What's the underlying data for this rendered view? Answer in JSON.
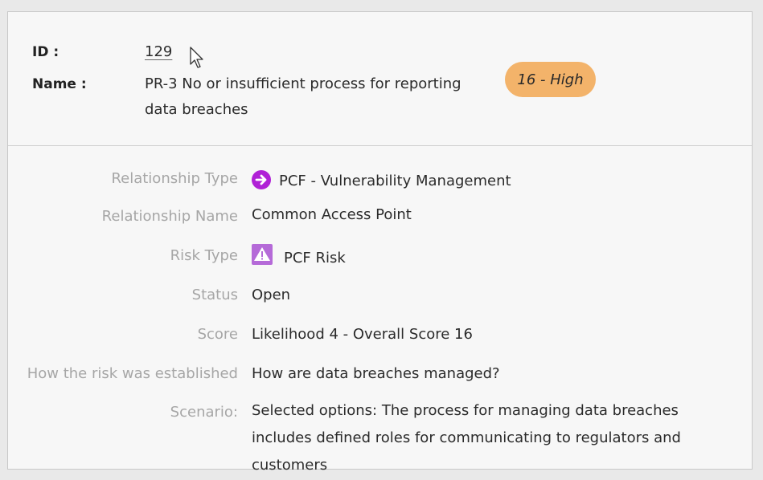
{
  "header": {
    "id_label": "ID :",
    "id_value": "129",
    "name_label": "Name :",
    "name_value": "PR-3 No or insufficient process for reporting data breaches",
    "badge": "16 - High"
  },
  "details": {
    "relationship_type": {
      "label": "Relationship Type",
      "value": "PCF - Vulnerability Management",
      "icon": "arrow-circle-right-icon"
    },
    "relationship_name": {
      "label": "Relationship Name",
      "value": "Common Access Point"
    },
    "risk_type": {
      "label": "Risk Type",
      "value": "PCF Risk",
      "icon": "warning-icon"
    },
    "status": {
      "label": "Status",
      "value": "Open"
    },
    "score": {
      "label": "Score",
      "value": "Likelihood 4 - Overall Score 16"
    },
    "established": {
      "label": "How the risk was established",
      "value": "How are data breaches managed?"
    },
    "scenario": {
      "label": "Scenario:",
      "value": "Selected options: The process for managing data breaches includes defined roles for communicating to regulators and customers"
    }
  },
  "colors": {
    "badge_bg": "#f3b36a",
    "arrow_icon": "#b021d6",
    "warning_icon": "#b56ad8",
    "label_gray": "#a6a6a6"
  }
}
